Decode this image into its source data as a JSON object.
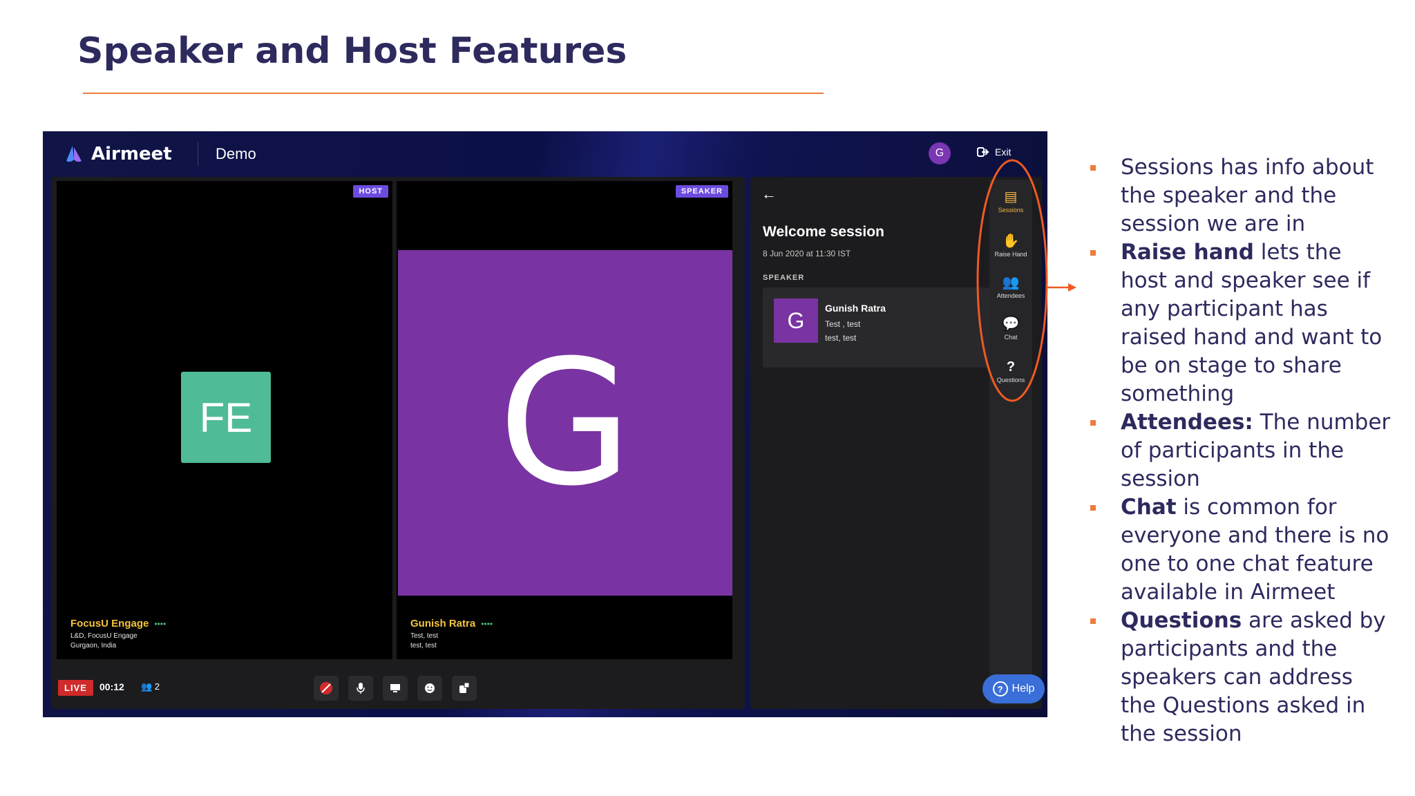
{
  "slide": {
    "title": "Speaker and Host Features"
  },
  "app": {
    "logo_text": "Airmeet",
    "event_name": "Demo",
    "user_initial": "G",
    "exit_label": "Exit",
    "tiles": [
      {
        "role": "HOST",
        "avatar": "FE",
        "name": "FocusU Engage",
        "line1": "L&D, FocusU Engage",
        "line2": "Gurgaon, India"
      },
      {
        "role": "SPEAKER",
        "avatar": "G",
        "name": "Gunish Ratra",
        "line1": "Test, test",
        "line2": "test, test"
      }
    ],
    "controls": {
      "live_label": "LIVE",
      "timer": "00:12",
      "attendee_count": "2"
    },
    "session": {
      "title": "Welcome session",
      "date": "8 Jun 2020 at 11:30 IST",
      "speaker_label": "SPEAKER",
      "speaker": {
        "initial": "G",
        "name": "Gunish Ratra",
        "line1": "Test , test",
        "line2": "test, test"
      }
    },
    "rail": [
      {
        "label": "Sessions",
        "icon": "sessions-icon",
        "glyph": "▤"
      },
      {
        "label": "Raise Hand",
        "icon": "raise-hand-icon",
        "glyph": "✋"
      },
      {
        "label": "Attendees",
        "icon": "attendees-icon",
        "glyph": "👥"
      },
      {
        "label": "Chat",
        "icon": "chat-icon",
        "glyph": "💬"
      },
      {
        "label": "Questions",
        "icon": "questions-icon",
        "glyph": "?"
      }
    ],
    "help_label": "Help"
  },
  "bullets": [
    {
      "bold": "",
      "rest": "Sessions has info about the speaker and the session we are in"
    },
    {
      "bold": "Raise hand",
      "rest": " lets the host and speaker see if any participant has raised hand and want to be on stage to share something"
    },
    {
      "bold": "Attendees:",
      "rest": " The number of participants in the session"
    },
    {
      "bold": "Chat",
      "rest": " is common for everyone and there is no one to one chat feature available in Airmeet"
    },
    {
      "bold": "Questions",
      "rest": " are asked by participants and the speakers can address the Questions asked in the session"
    }
  ],
  "colors": {
    "title": "#2d2a5e",
    "accent": "#ef7c3c",
    "host_avatar": "#4fbb97",
    "speaker_avatar": "#7a33a2",
    "badge": "#6c4ce0",
    "live": "#d02a2a",
    "help": "#3a6ed8"
  }
}
